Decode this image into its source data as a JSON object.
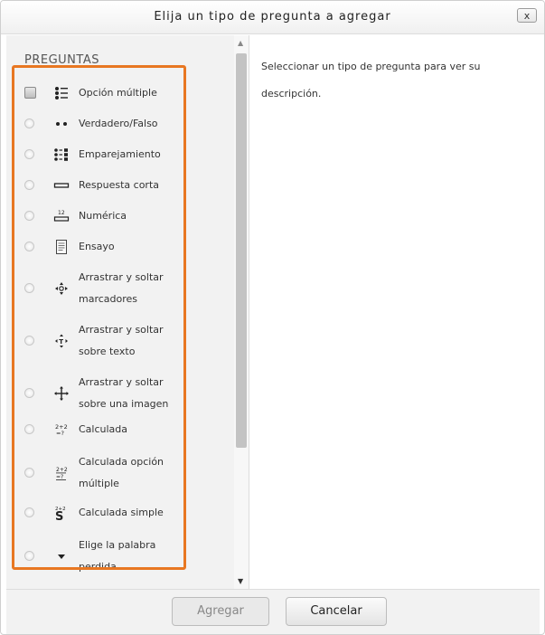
{
  "dialog": {
    "title": "Elija un tipo de pregunta a agregar",
    "close_label": "x"
  },
  "questions": {
    "heading": "PREGUNTAS",
    "items": [
      {
        "label": "Opción múltiple",
        "icon": "multichoice-icon"
      },
      {
        "label": "Verdadero/Falso",
        "icon": "truefalse-icon"
      },
      {
        "label": "Emparejamiento",
        "icon": "matching-icon"
      },
      {
        "label": "Respuesta corta",
        "icon": "shortanswer-icon"
      },
      {
        "label": "Numérica",
        "icon": "numerical-icon"
      },
      {
        "label": "Ensayo",
        "icon": "essay-icon"
      },
      {
        "label": "Arrastrar y soltar marcadores",
        "line1": "Arrastrar y soltar",
        "line2": "marcadores",
        "icon": "drag-markers-icon"
      },
      {
        "label": "Arrastrar y soltar sobre texto",
        "line1": "Arrastrar y soltar",
        "line2": "sobre texto",
        "icon": "drag-text-icon"
      },
      {
        "label": "Arrastrar y soltar sobre una imagen",
        "line1": "Arrastrar y soltar",
        "line2": "sobre una imagen",
        "icon": "drag-image-icon"
      },
      {
        "label": "Calculada",
        "icon": "calculated-icon"
      },
      {
        "label": "Calculada opción múltiple",
        "line1": "Calculada opción",
        "line2": "múltiple",
        "icon": "calculated-multi-icon"
      },
      {
        "label": "Calculada simple",
        "icon": "calculated-simple-icon"
      },
      {
        "label": "Elige la palabra perdida",
        "line1": "Elige la palabra",
        "line2": "perdida",
        "icon": "missing-word-icon"
      }
    ]
  },
  "description": {
    "text": "Seleccionar un tipo de pregunta para ver su descripción."
  },
  "footer": {
    "add_label": "Agregar",
    "cancel_label": "Cancelar"
  },
  "colors": {
    "highlight": "#e87722"
  }
}
